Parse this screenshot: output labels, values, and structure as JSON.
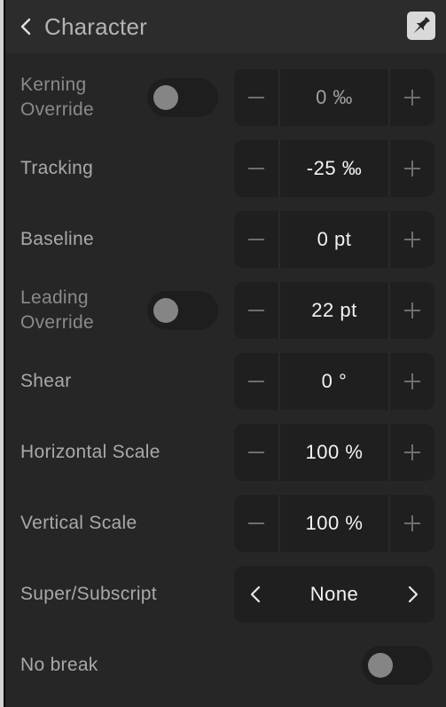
{
  "header": {
    "back_icon": "chevron-left-icon",
    "title": "Character",
    "pin_icon": "pin-icon"
  },
  "rows": [
    {
      "label": "Kerning Override",
      "label_lines": [
        "Kerning",
        "Override"
      ],
      "control": "toggle+stepper",
      "toggle_on": false,
      "value": "0 ‰",
      "enabled": false
    },
    {
      "label": "Tracking",
      "control": "stepper",
      "value": "-25 ‰",
      "enabled": true
    },
    {
      "label": "Baseline",
      "control": "stepper",
      "value": "0 pt",
      "enabled": true
    },
    {
      "label": "Leading Override",
      "label_lines": [
        "Leading",
        "Override"
      ],
      "control": "toggle+stepper",
      "toggle_on": false,
      "value": "22 pt",
      "enabled": true
    },
    {
      "label": "Shear",
      "control": "stepper",
      "value": "0 °",
      "enabled": true
    },
    {
      "label": "Horizontal Scale",
      "control": "stepper",
      "value": "100 %",
      "enabled": true
    },
    {
      "label": "Vertical Scale",
      "control": "stepper",
      "value": "100 %",
      "enabled": true
    },
    {
      "label": "Super/Subscript",
      "control": "picker",
      "value": "None",
      "enabled": true
    },
    {
      "label": "No break",
      "control": "toggle",
      "toggle_on": false,
      "enabled": true
    }
  ],
  "stepper": {
    "decrement": "−",
    "increment": "+"
  },
  "colors": {
    "panel_bg": "#262626",
    "header_bg": "#2c2c2c",
    "control_bg": "#1f1f1f",
    "label_text": "#a9a9a9",
    "value_text": "#f2f2f2",
    "toggle_knob_off": "#858585",
    "pin_button_bg": "#d9d9d9"
  }
}
